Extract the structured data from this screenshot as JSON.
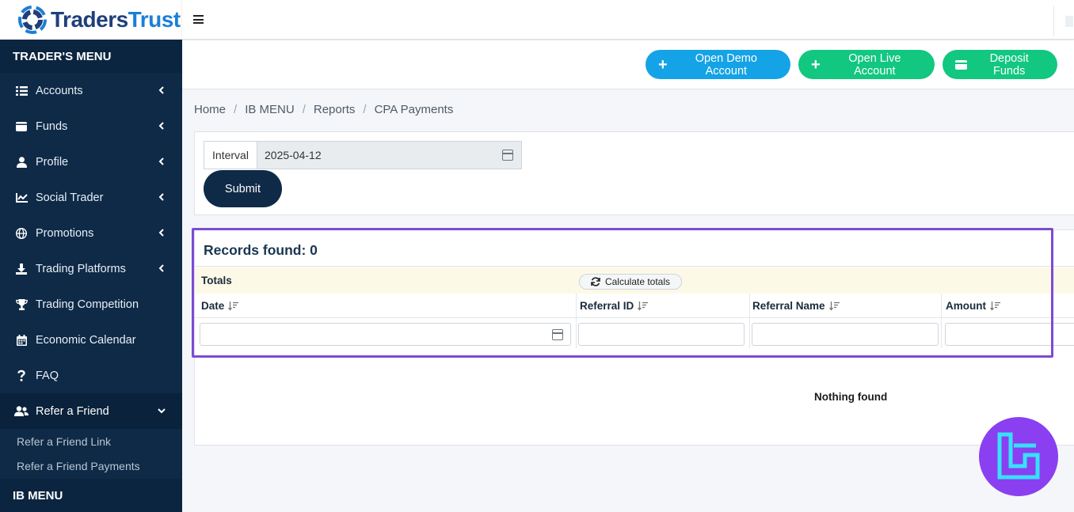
{
  "brand": {
    "name_part1": "Traders",
    "name_part2": "Trust"
  },
  "sidebar": {
    "header": "TRADER'S MENU",
    "items": [
      {
        "label": "Accounts",
        "icon": "list-icon",
        "has_chevron": true
      },
      {
        "label": "Funds",
        "icon": "wallet-icon",
        "has_chevron": true
      },
      {
        "label": "Profile",
        "icon": "user-icon",
        "has_chevron": true
      },
      {
        "label": "Social Trader",
        "icon": "chart-icon",
        "has_chevron": true
      },
      {
        "label": "Promotions",
        "icon": "globe-icon",
        "has_chevron": true
      },
      {
        "label": "Trading Platforms",
        "icon": "download-icon",
        "has_chevron": true
      },
      {
        "label": "Trading Competition",
        "icon": "trophy-icon",
        "has_chevron": false
      },
      {
        "label": "Economic Calendar",
        "icon": "calendar-icon",
        "has_chevron": false
      },
      {
        "label": "FAQ",
        "icon": "question-icon",
        "has_chevron": false
      },
      {
        "label": "Refer a Friend",
        "icon": "users-icon",
        "has_chevron": true,
        "expanded": true
      }
    ],
    "sub_items": [
      "Refer a Friend Link",
      "Refer a Friend Payments"
    ],
    "footer": "IB MENU"
  },
  "actions": {
    "demo_label": "Open Demo Account",
    "live_label": "Open Live Account",
    "deposit_label": "Deposit Funds",
    "demo_color": "#14a3e6",
    "live_color": "#12c77f"
  },
  "breadcrumb": [
    "Home",
    "IB MENU",
    "Reports",
    "CPA Payments"
  ],
  "filter": {
    "interval_label": "Interval",
    "interval_value": "2025-04-12",
    "submit_label": "Submit"
  },
  "records": {
    "title": "Records found: 0",
    "totals_label": "Totals",
    "calc_label": "Calculate totals",
    "columns": [
      "Date",
      "Referral ID",
      "Referral Name",
      "Amount"
    ],
    "empty_text": "Nothing found"
  },
  "colors": {
    "sidebar_bg": "#0e2a47",
    "highlight": "#7d4bd4",
    "badge": "#8a3ff0"
  }
}
